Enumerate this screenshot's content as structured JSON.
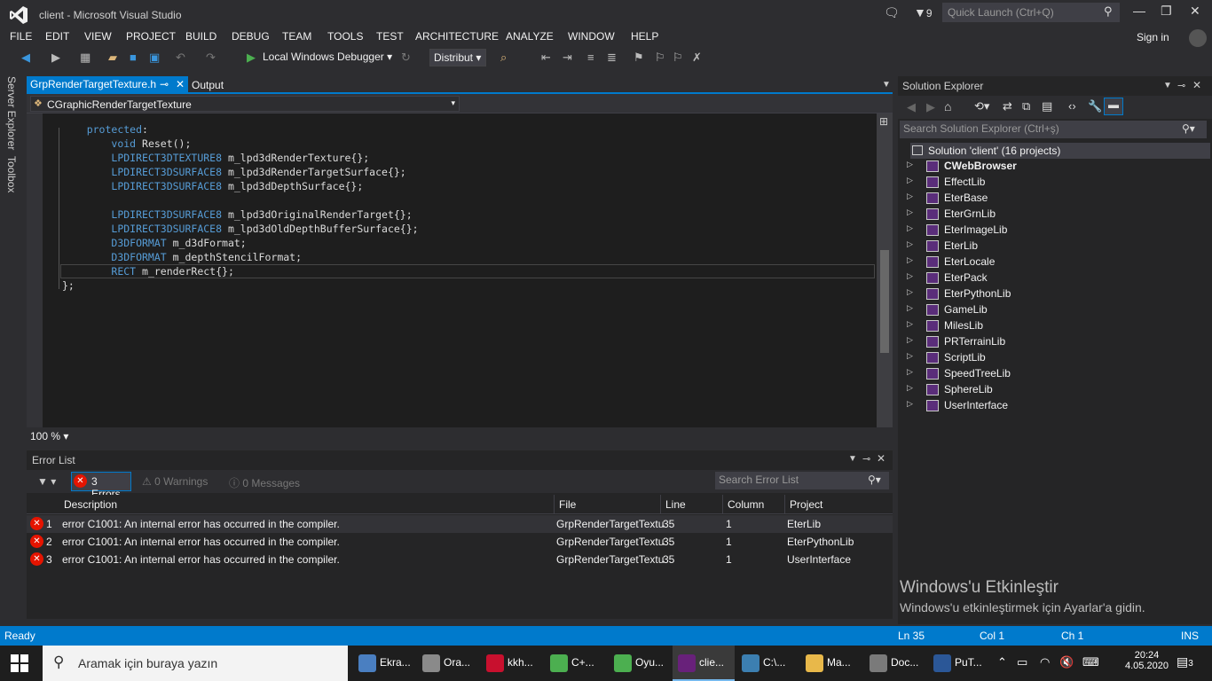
{
  "window": {
    "title": "client - Microsoft Visual Studio",
    "notification_count": "9",
    "quick_launch_placeholder": "Quick Launch (Ctrl+Q)"
  },
  "menu": [
    "FILE",
    "EDIT",
    "VIEW",
    "PROJECT",
    "BUILD",
    "DEBUG",
    "TEAM",
    "TOOLS",
    "TEST",
    "ARCHITECTURE",
    "ANALYZE",
    "WINDOW",
    "HELP"
  ],
  "sign_in": "Sign in",
  "toolbar": {
    "debugger_label": "Local Windows Debugger",
    "configuration": "Distribut"
  },
  "left_strip": {
    "server_explorer": "Server Explorer",
    "toolbox": "Toolbox"
  },
  "editor": {
    "active_tab": "GrpRenderTargetTexture.h",
    "output_tab": "Output",
    "nav_class": "CGraphicRenderTargetTexture",
    "zoom": "100 %",
    "lines": [
      {
        "indent": "    ",
        "parts": [
          {
            "t": "protected",
            "c": "kw"
          },
          {
            "t": ":",
            "c": ""
          }
        ]
      },
      {
        "indent": "        ",
        "parts": [
          {
            "t": "void",
            "c": "kw"
          },
          {
            "t": " Reset();",
            "c": ""
          }
        ]
      },
      {
        "indent": "        ",
        "parts": [
          {
            "t": "LPDIRECT3DTEXTURE8",
            "c": "kw"
          },
          {
            "t": " m_lpd3dRenderTexture{};",
            "c": ""
          }
        ]
      },
      {
        "indent": "        ",
        "parts": [
          {
            "t": "LPDIRECT3DSURFACE8",
            "c": "kw"
          },
          {
            "t": " m_lpd3dRenderTargetSurface{};",
            "c": ""
          }
        ]
      },
      {
        "indent": "        ",
        "parts": [
          {
            "t": "LPDIRECT3DSURFACE8",
            "c": "kw"
          },
          {
            "t": " m_lpd3dDepthSurface{};",
            "c": ""
          }
        ]
      },
      {
        "indent": "",
        "parts": []
      },
      {
        "indent": "        ",
        "parts": [
          {
            "t": "LPDIRECT3DSURFACE8",
            "c": "kw"
          },
          {
            "t": " m_lpd3dOriginalRenderTarget{};",
            "c": ""
          }
        ]
      },
      {
        "indent": "        ",
        "parts": [
          {
            "t": "LPDIRECT3DSURFACE8",
            "c": "kw"
          },
          {
            "t": " m_lpd3dOldDepthBufferSurface{};",
            "c": ""
          }
        ]
      },
      {
        "indent": "        ",
        "parts": [
          {
            "t": "D3DFORMAT",
            "c": "kw"
          },
          {
            "t": " m_d3dFormat;",
            "c": ""
          }
        ]
      },
      {
        "indent": "        ",
        "parts": [
          {
            "t": "D3DFORMAT",
            "c": "kw"
          },
          {
            "t": " m_depthStencilFormat;",
            "c": ""
          }
        ]
      },
      {
        "indent": "        ",
        "parts": [
          {
            "t": "RECT",
            "c": "kw"
          },
          {
            "t": " m_renderRect{};",
            "c": ""
          }
        ]
      },
      {
        "indent": "",
        "parts": [
          {
            "t": "};",
            "c": ""
          }
        ]
      }
    ]
  },
  "error_list": {
    "title": "Error List",
    "errors_filter": "3 Errors",
    "warnings_filter": "0 Warnings",
    "messages_filter": "0 Messages",
    "search_placeholder": "Search Error List",
    "columns": {
      "description": "Description",
      "file": "File",
      "line": "Line",
      "column": "Column",
      "project": "Project"
    },
    "rows": [
      {
        "num": "1",
        "description": "error C1001: An internal error has occurred in the compiler.",
        "file": "GrpRenderTargetTextu",
        "line": "35",
        "column": "1",
        "project": "EterLib"
      },
      {
        "num": "2",
        "description": "error C1001: An internal error has occurred in the compiler.",
        "file": "GrpRenderTargetTextu",
        "line": "35",
        "column": "1",
        "project": "EterPythonLib"
      },
      {
        "num": "3",
        "description": "error C1001: An internal error has occurred in the compiler.",
        "file": "GrpRenderTargetTextu",
        "line": "35",
        "column": "1",
        "project": "UserInterface"
      }
    ]
  },
  "solution_explorer": {
    "title": "Solution Explorer",
    "search_placeholder": "Search Solution Explorer (Ctrl+ş)",
    "root": "Solution 'client' (16 projects)",
    "projects": [
      "CWebBrowser",
      "EffectLib",
      "EterBase",
      "EterGrnLib",
      "EterImageLib",
      "EterLib",
      "EterLocale",
      "EterPack",
      "EterPythonLib",
      "GameLib",
      "MilesLib",
      "PRTerrainLib",
      "ScriptLib",
      "SpeedTreeLib",
      "SphereLib",
      "UserInterface"
    ]
  },
  "watermark": {
    "title": "Windows'u Etkinleştir",
    "subtitle": "Windows'u etkinleştirmek için Ayarlar'a gidin."
  },
  "status": {
    "state": "Ready",
    "ln": "Ln 35",
    "col": "Col 1",
    "ch": "Ch 1",
    "ins": "INS"
  },
  "taskbar": {
    "search_placeholder": "Aramak için buraya yazın",
    "apps": [
      {
        "label": "Ekra...",
        "color": "#4a7fc1"
      },
      {
        "label": "Ora...",
        "color": "#8a8a8a"
      },
      {
        "label": "kkh...",
        "color": "#c8102e"
      },
      {
        "label": "C+...",
        "color": "#4caf50"
      },
      {
        "label": "Oyu...",
        "color": "#4caf50"
      },
      {
        "label": "clie...",
        "color": "#68217a"
      },
      {
        "label": "C:\\...",
        "color": "#3c7fb1"
      },
      {
        "label": "Ma...",
        "color": "#e8b84a"
      },
      {
        "label": "Doc...",
        "color": "#7a7a7a"
      },
      {
        "label": "PuT...",
        "color": "#2b5797"
      }
    ],
    "time": "20:24",
    "date": "4.05.2020",
    "notifications": "3"
  }
}
